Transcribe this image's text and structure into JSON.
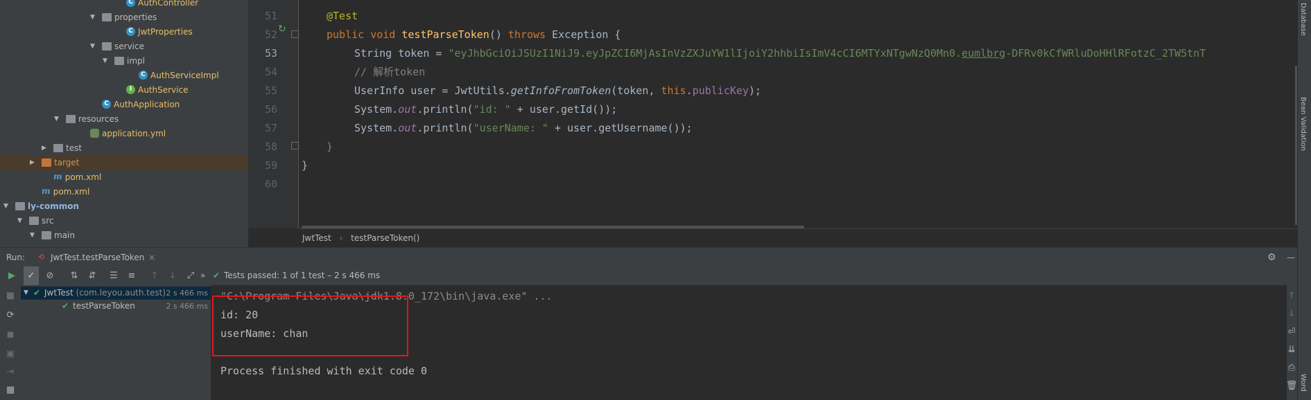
{
  "project_tree": [
    {
      "label": "AuthController",
      "icon": "class-icon",
      "indent": 185,
      "style": "yellow",
      "arrow": ""
    },
    {
      "label": "properties",
      "icon": "folder-icon",
      "indent": 150,
      "style": "",
      "arrow": "▼"
    },
    {
      "label": "JwtProperties",
      "icon": "class-icon",
      "indent": 185,
      "style": "yellow",
      "arrow": ""
    },
    {
      "label": "service",
      "icon": "folder-icon",
      "indent": 150,
      "style": "",
      "arrow": "▼"
    },
    {
      "label": "impl",
      "icon": "folder-icon",
      "indent": 168,
      "style": "",
      "arrow": "▼"
    },
    {
      "label": "AuthServiceImpl",
      "icon": "class-icon",
      "indent": 203,
      "style": "yellow",
      "arrow": ""
    },
    {
      "label": "AuthService",
      "icon": "interface-icon",
      "indent": 185,
      "style": "yellow",
      "arrow": ""
    },
    {
      "label": "AuthApplication",
      "icon": "class-icon",
      "indent": 150,
      "style": "yellow",
      "arrow": ""
    },
    {
      "label": "resources",
      "icon": "folder-icon",
      "indent": 98,
      "style": "",
      "arrow": "▼"
    },
    {
      "label": "application.yml",
      "icon": "yaml-icon",
      "indent": 133,
      "style": "yellow",
      "arrow": ""
    },
    {
      "label": "test",
      "icon": "folder-icon",
      "indent": 80,
      "style": "",
      "arrow": "▶"
    },
    {
      "label": "target",
      "icon": "folder-icon-orange",
      "indent": 63,
      "style": "orange",
      "arrow": "▶",
      "selected": true
    },
    {
      "label": "pom.xml",
      "icon": "maven-icon",
      "indent": 80,
      "style": "yellow",
      "arrow": ""
    },
    {
      "label": "pom.xml",
      "icon": "maven-icon",
      "indent": 63,
      "style": "yellow",
      "arrow": ""
    },
    {
      "label": "ly-common",
      "icon": "module-icon",
      "indent": 25,
      "style": "blue",
      "arrow": "▼"
    },
    {
      "label": "src",
      "icon": "folder-icon",
      "indent": 45,
      "style": "",
      "arrow": "▼"
    },
    {
      "label": "main",
      "icon": "folder-icon",
      "indent": 63,
      "style": "",
      "arrow": "▼"
    }
  ],
  "editor": {
    "line_numbers": [
      "51",
      "52",
      "53",
      "54",
      "55",
      "56",
      "57",
      "58",
      "59",
      "60"
    ],
    "current_line": "53",
    "annotation": "@Test",
    "kw_public": "public",
    "kw_void": "void",
    "method_name": "testParseToken",
    "paren_open": "() ",
    "kw_throws": "throws",
    "exception_tail": " Exception {",
    "token_decl": "String token = ",
    "token_value_a": "\"eyJhbGciOiJSUzI1NiJ9.eyJpZCI6MjAsInVzZXJuYW1lIjoiY2hhbiIsImV4cCI6MTYxNTgwNzQ0Mn0.",
    "token_value_b": "eumlbrg",
    "token_value_c": "-DFRv0kCfWRluDoHHlRFotzC_2TW5tnT",
    "comment": "// 解析token",
    "userinfo_a": "UserInfo user = JwtUtils.",
    "userinfo_method": "getInfoFromToken",
    "userinfo_b": "(token, ",
    "kw_this": "this",
    "userinfo_c": ".",
    "field_publickey": "publicKey",
    "userinfo_d": ");",
    "println1_a": "System.",
    "println_out": "out",
    "println1_b": ".println(",
    "println1_str": "\"id: \"",
    "println1_c": " + user.getId());",
    "println2_str": "\"userName: \"",
    "println2_c": " + user.getUsername());",
    "close_brace_method": "}",
    "close_brace_class": "}"
  },
  "breadcrumb": {
    "class": "JwtTest",
    "sep": "›",
    "method": "testParseToken()"
  },
  "right_strip": {
    "label_top": "Database",
    "label_mid": "Bean Validation",
    "label_bottom": "Word"
  },
  "run": {
    "label": "Run:",
    "tab": "JwtTest.testParseToken",
    "status": "Tests passed: 1 of 1 test – 2 s 466 ms",
    "more": "»",
    "tree": [
      {
        "label": "JwtTest",
        "extra": " (com.leyou.auth.test)",
        "time": "2 s 466 ms",
        "arrow": "▼"
      },
      {
        "label": "testParseToken",
        "extra": "",
        "time": "2 s 466 ms",
        "arrow": ""
      }
    ]
  },
  "console": {
    "lines": [
      "\"C:\\Program Files\\Java\\jdk1.8.0_172\\bin\\java.exe\" ...",
      "id: 20",
      "userName: chan",
      "",
      "Process finished with exit code 0"
    ]
  }
}
